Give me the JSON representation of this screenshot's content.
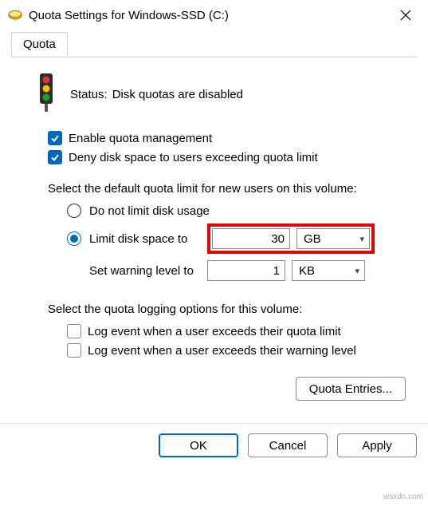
{
  "window": {
    "title": "Quota Settings for Windows-SSD (C:)"
  },
  "tab": {
    "label": "Quota"
  },
  "status": {
    "label": "Status:",
    "text": "Disk quotas are disabled"
  },
  "checks": {
    "enable": "Enable quota management",
    "deny": "Deny disk space to users exceeding quota limit"
  },
  "default_limit": {
    "heading": "Select the default quota limit for new users on this volume:",
    "no_limit": "Do not limit disk usage",
    "limit_label": "Limit disk space to",
    "limit_value": "30",
    "limit_unit": "GB",
    "warn_label": "Set warning level to",
    "warn_value": "1",
    "warn_unit": "KB"
  },
  "logging": {
    "heading": "Select the quota logging options for this volume:",
    "exceed_quota": "Log event when a user exceeds their quota limit",
    "exceed_warn": "Log event when a user exceeds their warning level"
  },
  "buttons": {
    "entries": "Quota Entries...",
    "ok": "OK",
    "cancel": "Cancel",
    "apply": "Apply"
  },
  "watermark": "wsxdn.com"
}
